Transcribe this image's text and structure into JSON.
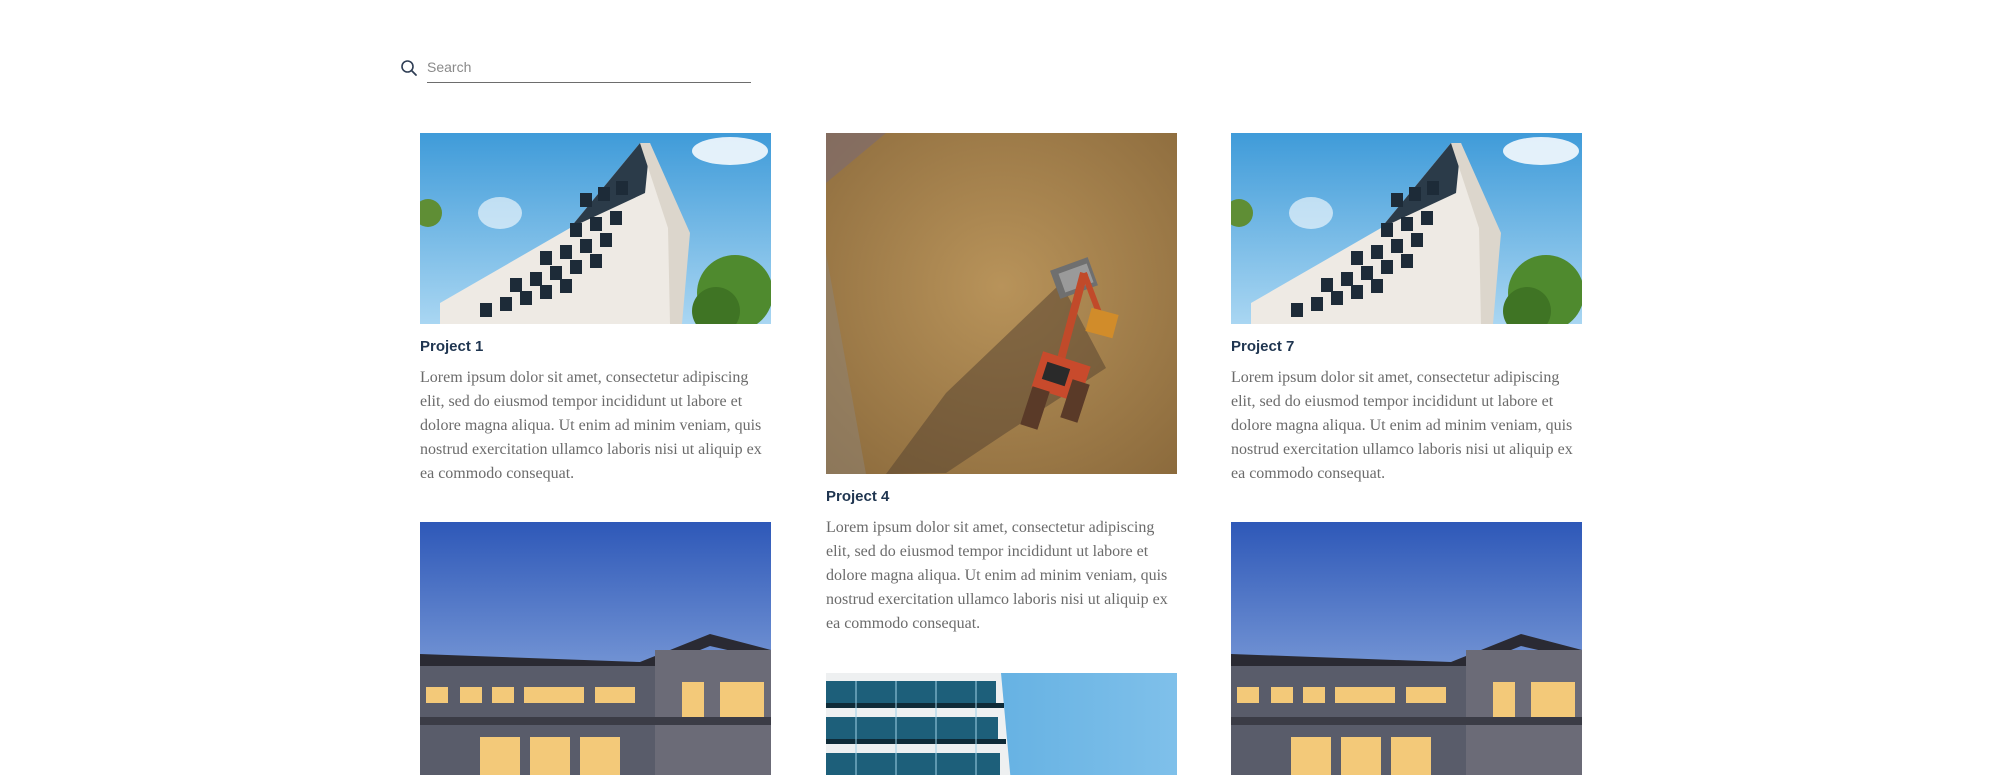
{
  "search": {
    "placeholder": "Search",
    "value": ""
  },
  "projects": [
    {
      "title": "Project 1",
      "image": "apartment-building",
      "description": "Lorem ipsum dolor sit amet, consectetur adipiscing elit, sed do eiusmod tempor incididunt ut labore et dolore magna aliqua. Ut enim ad minim veniam, quis nostrud exercitation ullamco laboris nisi ut aliquip ex ea commodo consequat."
    },
    {
      "title": "Project 4",
      "image": "excavator-aerial",
      "description": "Lorem ipsum dolor sit amet, consectetur adipiscing elit, sed do eiusmod tempor incididunt ut labore et dolore magna aliqua. Ut enim ad minim veniam, quis nostrud exercitation ullamco laboris nisi ut aliquip ex ea commodo consequat."
    },
    {
      "title": "Project 7",
      "image": "apartment-building",
      "description": "Lorem ipsum dolor sit amet, consectetur adipiscing elit, sed do eiusmod tempor incididunt ut labore et dolore magna aliqua. Ut enim ad minim veniam, quis nostrud exercitation ullamco laboris nisi ut aliquip ex ea commodo consequat."
    },
    {
      "title": "",
      "image": "modern-house",
      "description": ""
    },
    {
      "title": "",
      "image": "glass-tower",
      "description": ""
    },
    {
      "title": "",
      "image": "modern-house",
      "description": ""
    }
  ],
  "colors": {
    "title": "#1f3550",
    "text": "#6b6b6b",
    "sky": "#5aa9dd",
    "dusk": "#2e58b8"
  }
}
